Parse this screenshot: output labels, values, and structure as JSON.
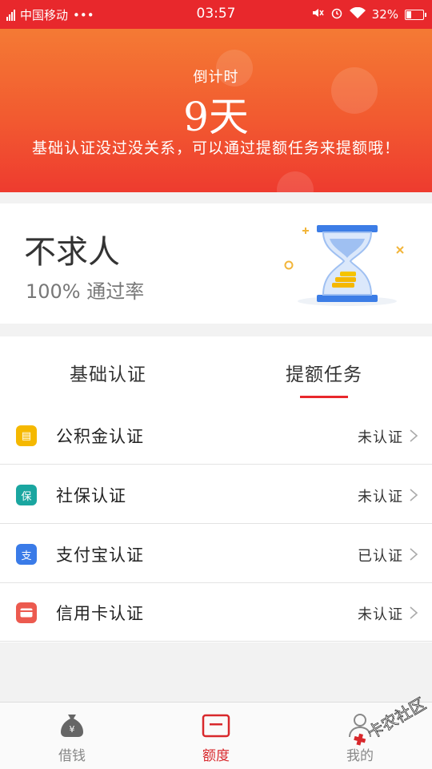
{
  "status_bar": {
    "carrier": "中国移动",
    "more": "•••",
    "time": "03:57",
    "battery": "32%",
    "battery_level": 0.32
  },
  "hero": {
    "label": "倒计时",
    "days": "9天",
    "tip": "基础认证没过没关系，可以通过提额任务来提额哦！"
  },
  "rate_card": {
    "title": "不求人",
    "subtitle": "100% 通过率"
  },
  "tabs": [
    {
      "label": "基础认证",
      "active": false
    },
    {
      "label": "提额任务",
      "active": true
    }
  ],
  "items": [
    {
      "label": "公积金认证",
      "status": "未认证",
      "icon_color": "#f5b800",
      "icon": "document-icon",
      "glyph": "▤"
    },
    {
      "label": "社保认证",
      "status": "未认证",
      "icon_color": "#1aa6a0",
      "icon": "social-security-icon",
      "glyph": "保"
    },
    {
      "label": "支付宝认证",
      "status": "已认证",
      "icon_color": "#3a7be8",
      "icon": "alipay-icon",
      "glyph": "支"
    },
    {
      "label": "信用卡认证",
      "status": "未认证",
      "icon_color": "#ec5a4f",
      "icon": "credit-card-icon",
      "glyph": "▬"
    }
  ],
  "bottom_nav": [
    {
      "label": "借钱",
      "icon": "money-bag-icon",
      "active": false
    },
    {
      "label": "额度",
      "icon": "quota-card-icon",
      "active": true
    },
    {
      "label": "我的",
      "icon": "profile-icon",
      "active": false
    }
  ],
  "watermark": "卡农社区",
  "colors": {
    "accent": "#e8282c",
    "hero_top": "#f47a34",
    "hero_bottom": "#ee3b2f"
  }
}
